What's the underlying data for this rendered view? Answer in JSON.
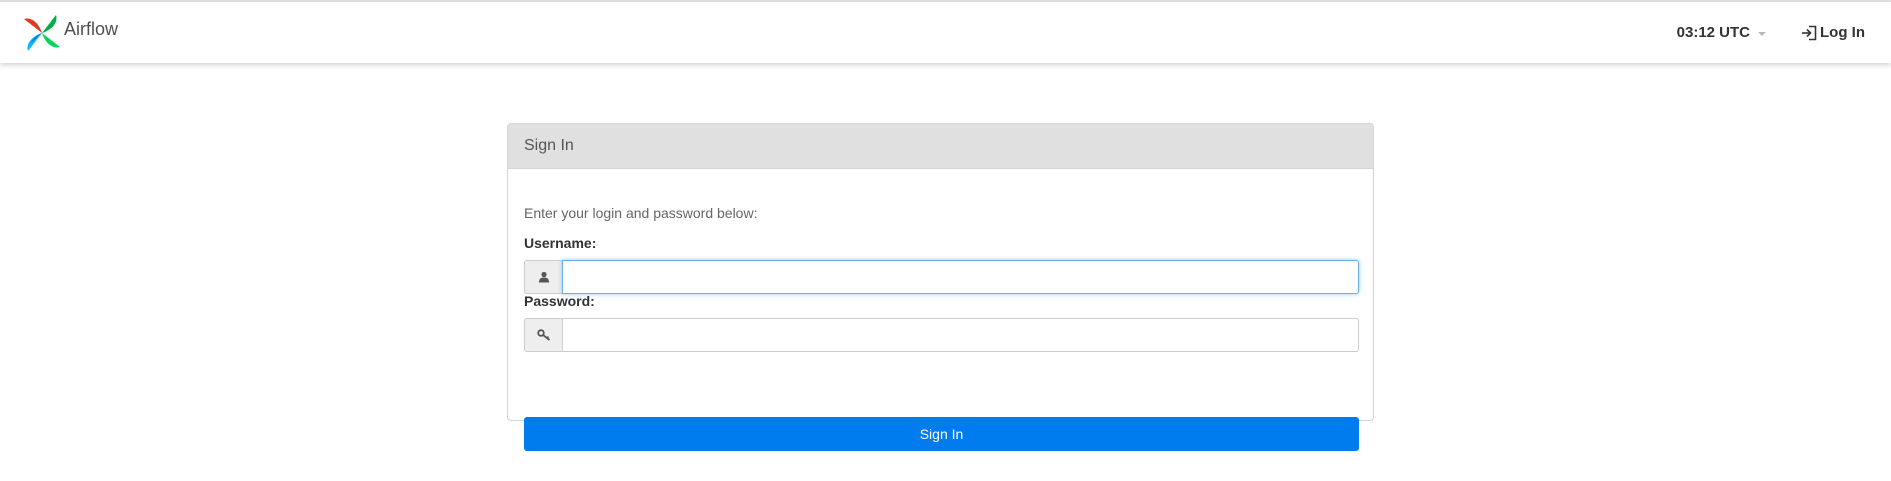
{
  "navbar": {
    "brand_name": "Airflow",
    "clock": "03:12 UTC",
    "login_label": "Log In"
  },
  "panel": {
    "title": "Sign In",
    "instruction": "Enter your login and password below:",
    "username_label": "Username:",
    "username_value": "",
    "password_label": "Password:",
    "password_value": "",
    "submit_label": "Sign In"
  },
  "icons": {
    "brand": "airflow-pinwheel-logo",
    "login": "sign-in-icon",
    "username": "user-icon",
    "password": "key-icon",
    "clock_menu": "caret-down-icon"
  },
  "colors": {
    "primary_button": "#017cee",
    "panel_heading_bg": "#e0e0e0",
    "focus_border": "#66afe9"
  }
}
